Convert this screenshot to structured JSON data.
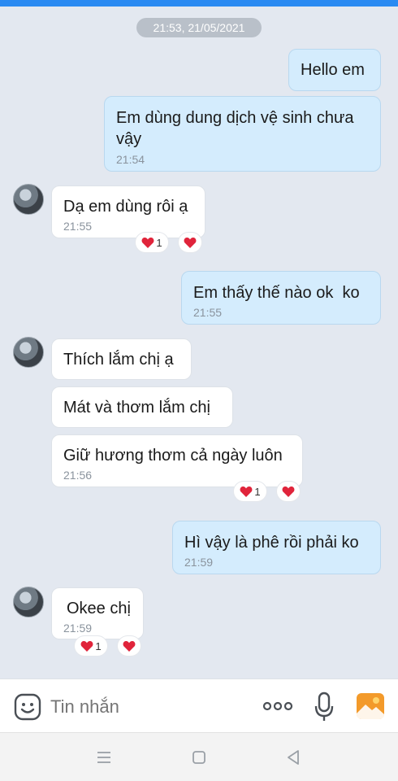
{
  "conversation": {
    "date_separator": "21:53, 21/05/2021",
    "messages": [
      {
        "id": "m1",
        "direction": "out",
        "text": "Hello em",
        "time": ""
      },
      {
        "id": "m2",
        "direction": "out",
        "text": "Em dùng dung dịch vệ sinh chưa vậy",
        "text_line1": "Em dùng dung dịch vệ sinh chưa",
        "text_line2": "vậy",
        "time": "21:54"
      },
      {
        "id": "m3",
        "direction": "in",
        "text": "Dạ em dùng rôi ạ",
        "time": "21:55",
        "reaction_count": "1"
      },
      {
        "id": "m4",
        "direction": "out",
        "text": "Em thấy thế nào ok  ko",
        "time": "21:55"
      },
      {
        "id": "m5",
        "direction": "in",
        "text": "Thích lắm chị ạ",
        "time": ""
      },
      {
        "id": "m6",
        "direction": "in",
        "text": "Mát và thơm lắm chị",
        "time": ""
      },
      {
        "id": "m7",
        "direction": "in",
        "text": "Giữ hương thơm cả ngày luôn",
        "time": "21:56",
        "reaction_count": "1"
      },
      {
        "id": "m8",
        "direction": "out",
        "text": "Hì vậy là phê rồi phải ko",
        "time": "21:59"
      },
      {
        "id": "m9",
        "direction": "in",
        "text": "Okee chị",
        "time": "21:59",
        "reaction_count": "1"
      }
    ]
  },
  "composer": {
    "placeholder": "Tin nhắn",
    "icons": [
      "emoji-icon",
      "more-icon",
      "microphone-icon",
      "image-icon"
    ]
  },
  "system_nav": {
    "icons": [
      "menu-icon",
      "home-icon",
      "back-icon"
    ]
  },
  "colors": {
    "accent": "#2a8af2",
    "outgoing_bubble": "#d4ecfd",
    "incoming_bubble": "#ffffff",
    "background": "#e3e8f0",
    "heart": "#e0243b",
    "image_icon": "#f39a2a"
  }
}
